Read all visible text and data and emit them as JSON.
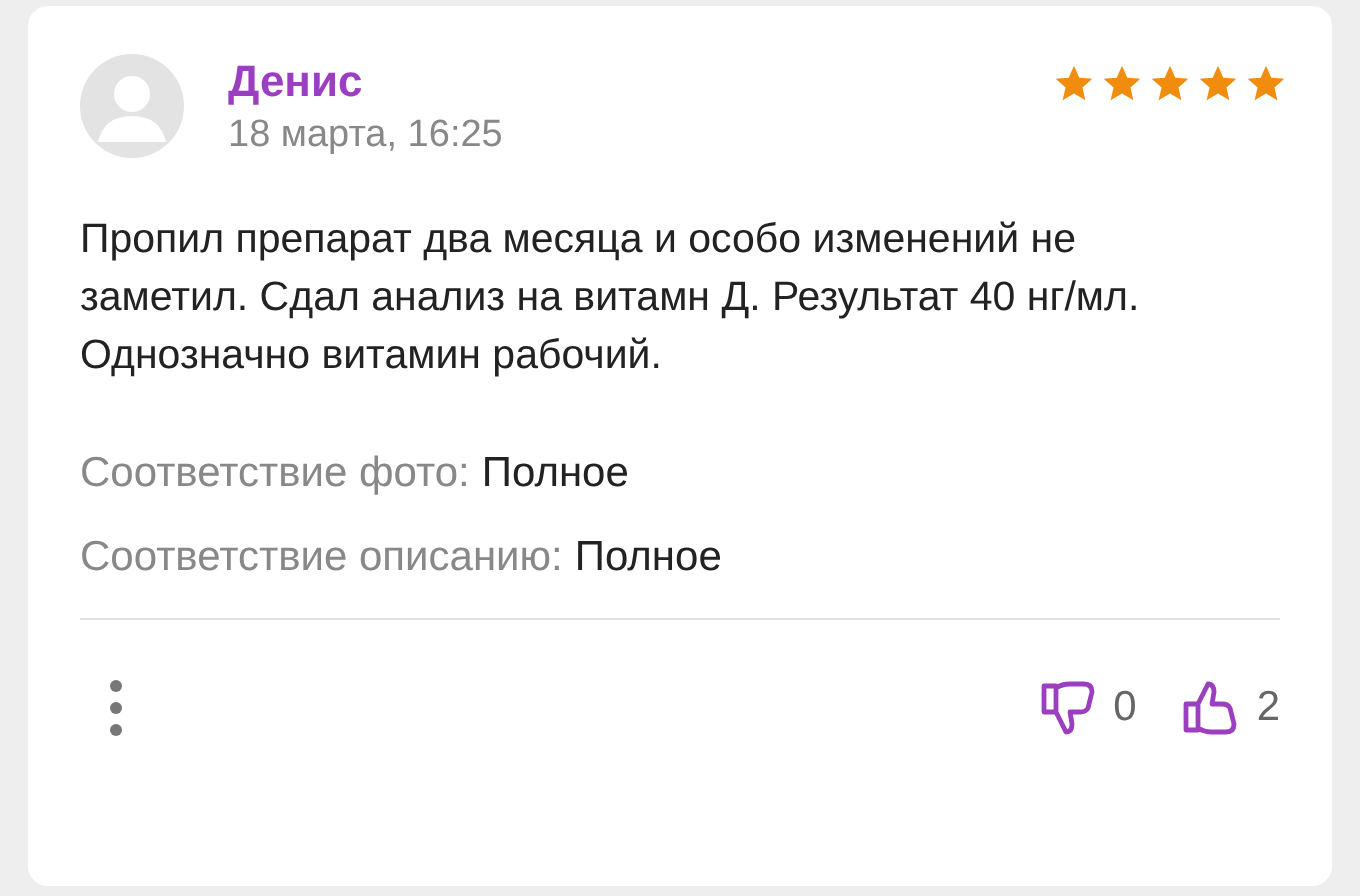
{
  "review": {
    "author": "Денис",
    "date": "18 марта, 16:25",
    "stars": 5,
    "text": "Пропил препарат два месяца и особо изменений не заметил. Сдал анализ на витамн Д. Результат 40 нг/мл. Однозначно витамин рабочий.",
    "attributes": [
      {
        "label": "Соответствие фото:",
        "value": "Полное"
      },
      {
        "label": "Соответствие описанию:",
        "value": "Полное"
      }
    ],
    "dislikes": "0",
    "likes": "2"
  }
}
